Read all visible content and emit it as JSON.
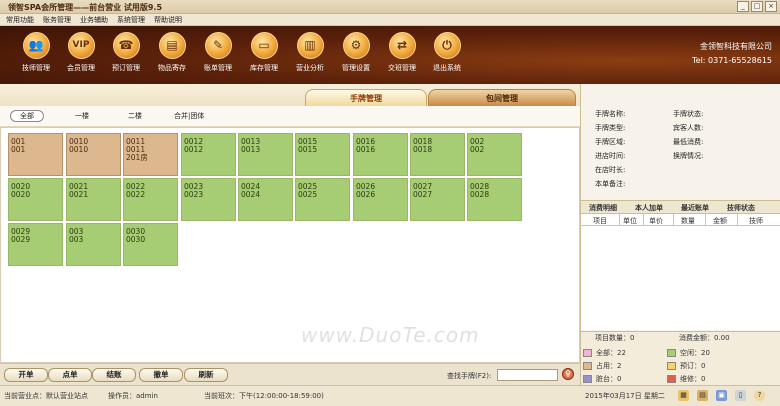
{
  "window": {
    "title": "领智SPA会所管理——前台营业 试用版9.5",
    "buttons": [
      "_",
      "□",
      "×"
    ]
  },
  "menu": [
    "常用功能",
    "账务管理",
    "业务辅助",
    "系统管理",
    "帮助说明"
  ],
  "toolbar": [
    {
      "label": "技师管理",
      "icon": "technician-icon",
      "glyph": "👥"
    },
    {
      "label": "会员管理",
      "icon": "vip-icon",
      "glyph": "VIP"
    },
    {
      "label": "预订管理",
      "icon": "phone-icon",
      "glyph": "☎"
    },
    {
      "label": "物品寄存",
      "icon": "storage-icon",
      "glyph": "▤"
    },
    {
      "label": "账单管理",
      "icon": "bill-icon",
      "glyph": "✎"
    },
    {
      "label": "库存管理",
      "icon": "folder-icon",
      "glyph": "▭"
    },
    {
      "label": "营业分析",
      "icon": "chart-icon",
      "glyph": "▥"
    },
    {
      "label": "管理设置",
      "icon": "gear-icon",
      "glyph": "⚙"
    },
    {
      "label": "交班管理",
      "icon": "handover-icon",
      "glyph": "⇄"
    },
    {
      "label": "退出系统",
      "icon": "power-icon",
      "glyph": "⏻"
    }
  ],
  "company": {
    "name": "金领智科技有限公司",
    "tel": "Tel: 0371-65528615"
  },
  "tabs": {
    "hand": "手牌管理",
    "room": "包间管理"
  },
  "floors": [
    "全部",
    "一楼",
    "二楼",
    "合并|团体"
  ],
  "cards": [
    {
      "a": "001",
      "b": "001",
      "c": "",
      "used": true
    },
    {
      "a": "0010",
      "b": "0010",
      "c": "",
      "used": true
    },
    {
      "a": "0011",
      "b": "0011",
      "c": "201房",
      "used": true
    },
    {
      "a": "0012",
      "b": "0012",
      "c": "",
      "used": false
    },
    {
      "a": "0013",
      "b": "0013",
      "c": "",
      "used": false
    },
    {
      "a": "0015",
      "b": "0015",
      "c": "",
      "used": false
    },
    {
      "a": "0016",
      "b": "0016",
      "c": "",
      "used": false
    },
    {
      "a": "0018",
      "b": "0018",
      "c": "",
      "used": false
    },
    {
      "a": "002",
      "b": "002",
      "c": "",
      "used": false
    },
    {
      "a": "0020",
      "b": "0020",
      "c": "",
      "used": false
    },
    {
      "a": "0021",
      "b": "0021",
      "c": "",
      "used": false
    },
    {
      "a": "0022",
      "b": "0022",
      "c": "",
      "used": false
    },
    {
      "a": "0023",
      "b": "0023",
      "c": "",
      "used": false
    },
    {
      "a": "0024",
      "b": "0024",
      "c": "",
      "used": false
    },
    {
      "a": "0025",
      "b": "0025",
      "c": "",
      "used": false
    },
    {
      "a": "0026",
      "b": "0026",
      "c": "",
      "used": false
    },
    {
      "a": "0027",
      "b": "0027",
      "c": "",
      "used": false
    },
    {
      "a": "0028",
      "b": "0028",
      "c": "",
      "used": false
    },
    {
      "a": "0029",
      "b": "0029",
      "c": "",
      "used": false
    },
    {
      "a": "003",
      "b": "003",
      "c": "",
      "used": false
    },
    {
      "a": "0030",
      "b": "0030",
      "c": "",
      "used": false
    }
  ],
  "actions": [
    "开单",
    "点单",
    "结账",
    "撤单",
    "刷新"
  ],
  "search": {
    "label": "查找手牌(F2):"
  },
  "status": {
    "site": "当前营业点：默认营业站点",
    "operator": "操作员：admin",
    "shift": "当前班次：下午(12:00:00-18:59:00)",
    "date": "2015年03月17日 星期二"
  },
  "info": {
    "left": [
      "手牌名称:",
      "手牌类型:",
      "手牌区域:",
      "进店时间:",
      "在店时长:",
      "本单备注:"
    ],
    "right": [
      "手牌状态:",
      "宾客人数:",
      "最低消费:",
      "换牌情况:"
    ]
  },
  "order_tabs": [
    "消费明细",
    "本人加单",
    "最近账单",
    "技师状态"
  ],
  "order_columns": [
    "项目",
    "单位",
    "单价",
    "数量",
    "金额",
    "技师"
  ],
  "totals": {
    "qty": "项目数量：0",
    "amount": "消费金额：0.00"
  },
  "legend": [
    {
      "label": "全部：22",
      "color": "#f0b3d8"
    },
    {
      "label": "空闲：20",
      "color": "#a6cc74"
    },
    {
      "label": "占用：2",
      "color": "#ddb78e"
    },
    {
      "label": "预订：0",
      "color": "#f3d36b"
    },
    {
      "label": "脏台：0",
      "color": "#9c8fd0"
    },
    {
      "label": "维修：0",
      "color": "#e06050"
    }
  ],
  "watermark": "www.DuoTe.com"
}
